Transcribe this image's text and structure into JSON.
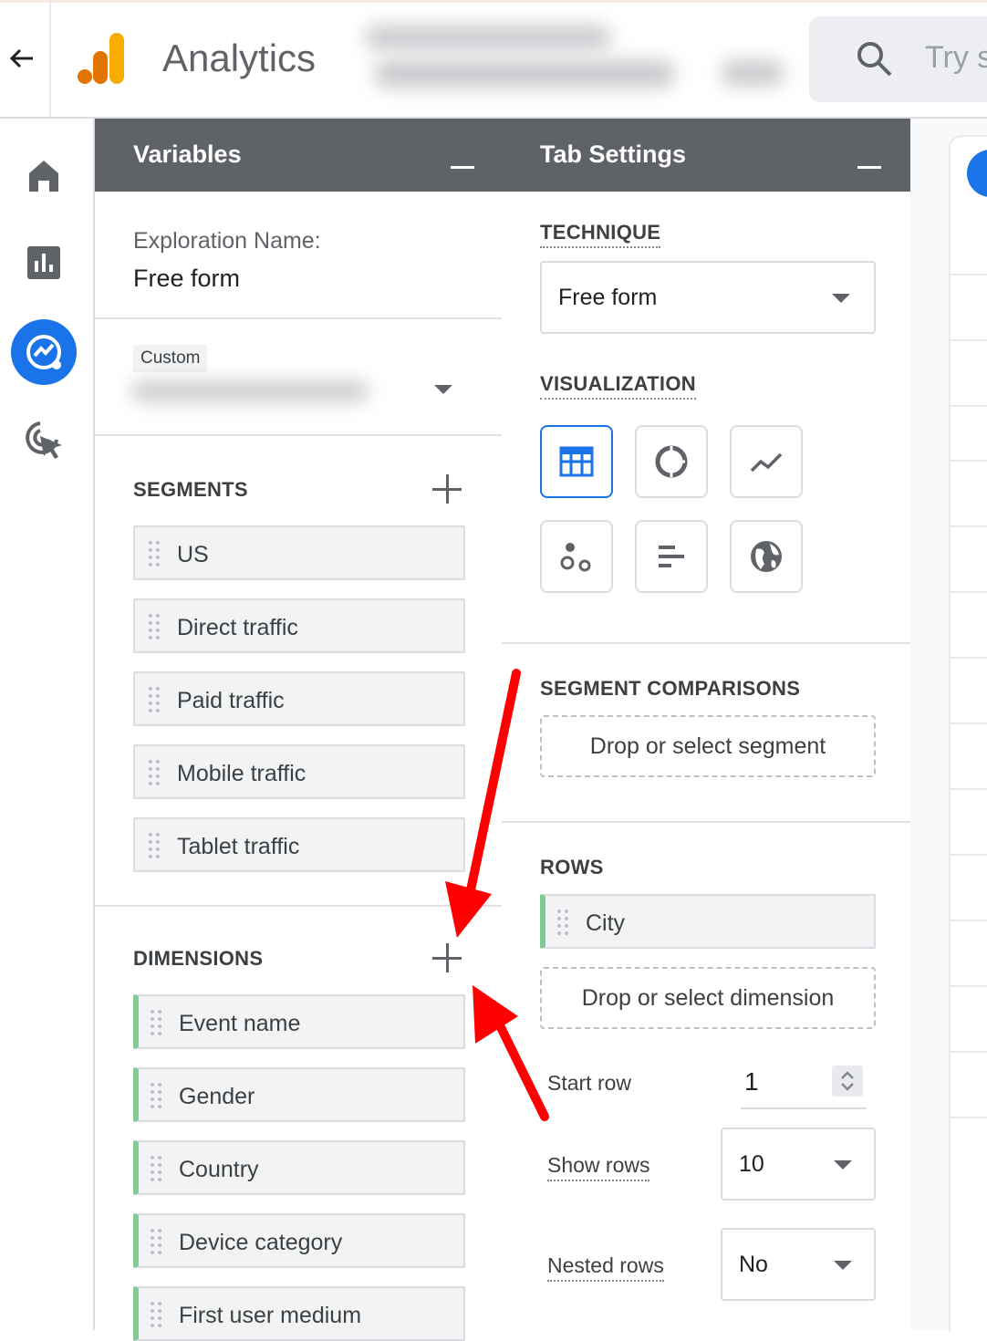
{
  "topbar": {
    "app_title": "Analytics",
    "search_placeholder": "Try s"
  },
  "variables": {
    "header": "Variables",
    "exploration_label": "Exploration Name:",
    "exploration_value": "Free form",
    "date_tag": "Custom",
    "segments_label": "SEGMENTS",
    "segments": [
      "US",
      "Direct traffic",
      "Paid traffic",
      "Mobile traffic",
      "Tablet traffic"
    ],
    "dimensions_label": "DIMENSIONS",
    "dimensions": [
      "Event name",
      "Gender",
      "Country",
      "Device category",
      "First user medium"
    ]
  },
  "tab_settings": {
    "header": "Tab Settings",
    "technique_label": "TECHNIQUE",
    "technique_value": "Free form",
    "visualization_label": "VISUALIZATION",
    "visualizations": [
      "table-icon",
      "donut-chart-icon",
      "line-chart-icon",
      "scatter-plot-icon",
      "bar-chart-icon",
      "geo-map-icon"
    ],
    "segment_comparisons_label": "SEGMENT COMPARISONS",
    "segment_drop": "Drop or select segment",
    "rows_label": "ROWS",
    "rows": [
      "City"
    ],
    "dimension_drop": "Drop or select dimension",
    "start_row_label": "Start row",
    "start_row_value": "1",
    "show_rows_label": "Show rows",
    "show_rows_value": "10",
    "nested_rows_label": "Nested rows",
    "nested_rows_value": "No"
  },
  "colors": {
    "accent": "#1a73e8",
    "header_bg": "#5f6368",
    "chip_accent": "#81c995",
    "arrow": "#ff0000"
  }
}
